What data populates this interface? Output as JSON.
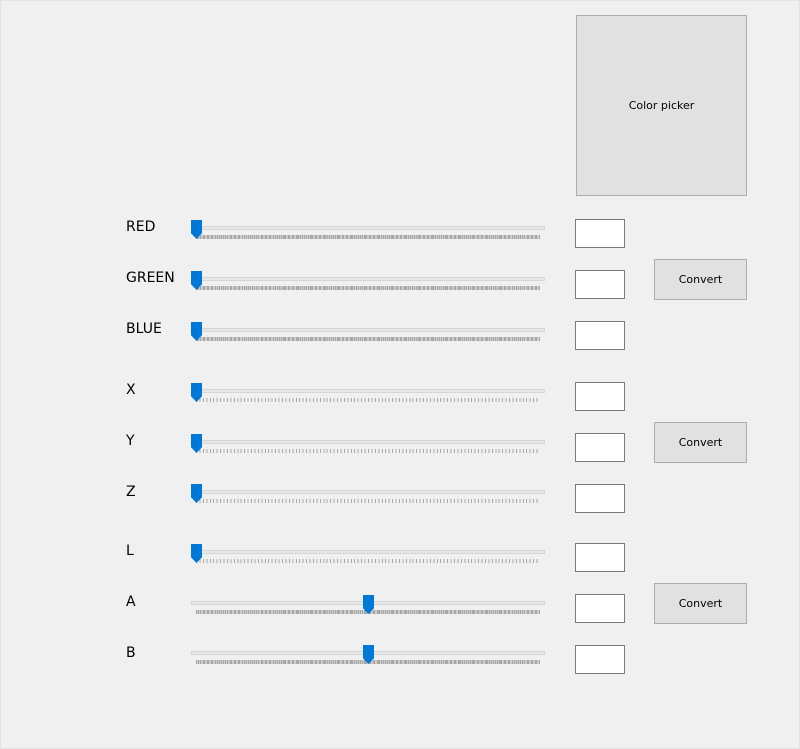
{
  "color_picker": {
    "label": "Color picker"
  },
  "rgb": {
    "convert_label": "Convert",
    "sliders": [
      {
        "label": "RED",
        "value": 0,
        "max": 255,
        "value_text": ""
      },
      {
        "label": "GREEN",
        "value": 0,
        "max": 255,
        "value_text": ""
      },
      {
        "label": "BLUE",
        "value": 0,
        "max": 255,
        "value_text": ""
      }
    ]
  },
  "xyz": {
    "convert_label": "Convert",
    "sliders": [
      {
        "label": "X",
        "value": 0,
        "max": 100,
        "value_text": ""
      },
      {
        "label": "Y",
        "value": 0,
        "max": 100,
        "value_text": ""
      },
      {
        "label": "Z",
        "value": 0,
        "max": 100,
        "value_text": ""
      }
    ]
  },
  "lab": {
    "convert_label": "Convert",
    "sliders": [
      {
        "label": "L",
        "value": 0,
        "max": 100,
        "value_text": ""
      },
      {
        "label": "A",
        "value": 0.5,
        "max": 1,
        "value_text": ""
      },
      {
        "label": "B",
        "value": 0.5,
        "max": 1,
        "value_text": ""
      }
    ]
  },
  "colors": {
    "accent": "#0078d7",
    "button_bg": "#e1e1e1",
    "window_bg": "#f0f0f0"
  }
}
